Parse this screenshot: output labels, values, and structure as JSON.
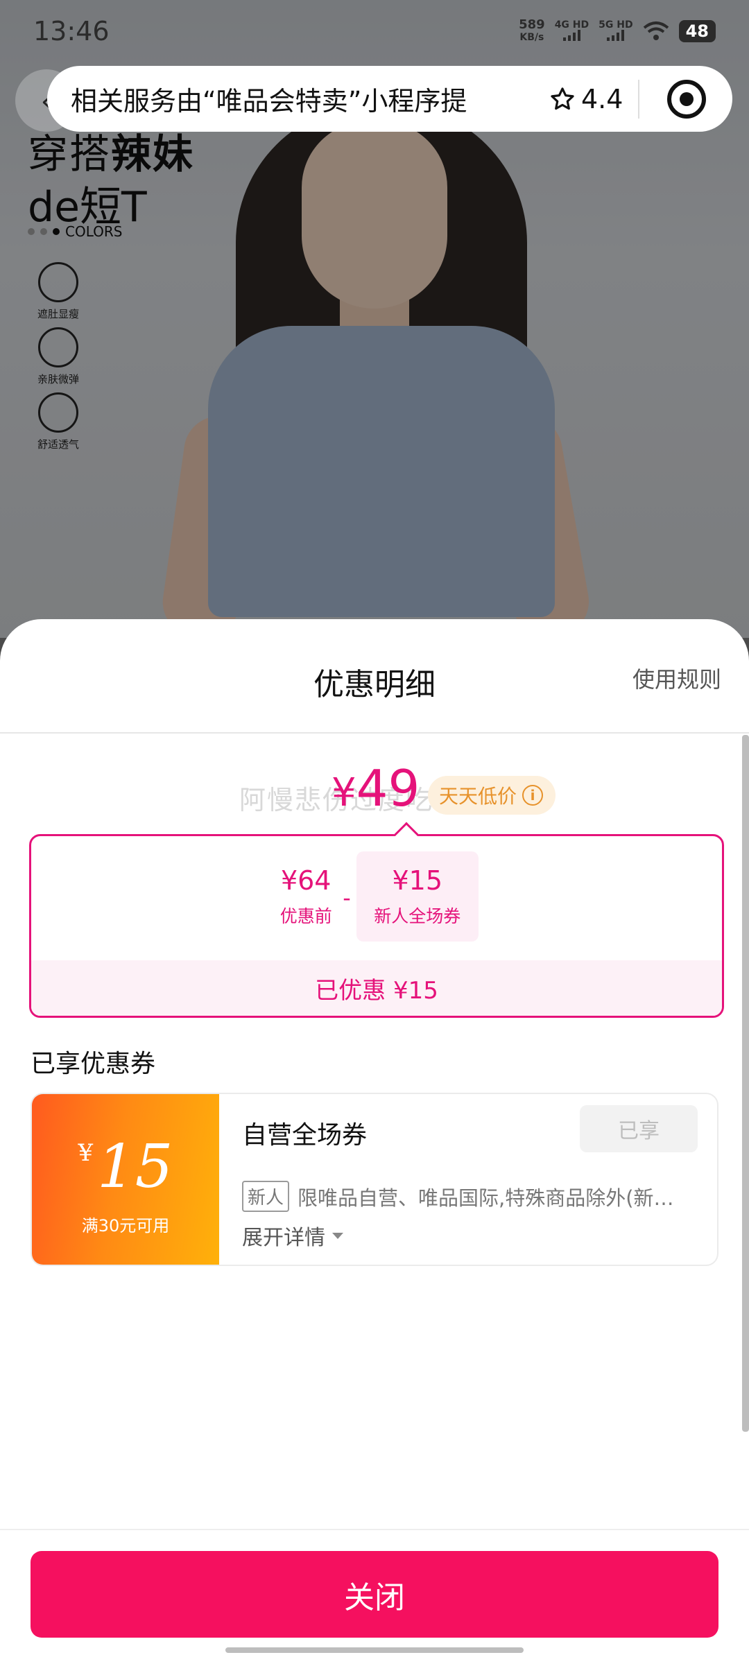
{
  "status_bar": {
    "time": "13:46",
    "net_speed_value": "589",
    "net_speed_unit": "KB/s",
    "sim1": "4G HD",
    "sim2": "5G HD",
    "battery": "48"
  },
  "capsule": {
    "text": "相关服务由“唯品会特卖”小程序提",
    "rating": "4.4"
  },
  "product_image": {
    "headline_light": "穿搭",
    "headline_bold": "辣妹",
    "headline_line2": "de短T",
    "colors_label": "COLORS",
    "features": [
      "遮肚显瘦",
      "亲肤微弹",
      "舒适透气"
    ]
  },
  "sheet": {
    "title": "优惠明细",
    "rules_link": "使用规则",
    "watermark": "阿慢悲伤过度吃嘛",
    "final_price_symbol": "¥",
    "final_price": "49",
    "low_price_badge": "天天低价",
    "calc": {
      "original_amount": "¥64",
      "original_label": "优惠前",
      "minus": "-",
      "discount_amount": "¥15",
      "discount_label": "新人全场券",
      "total_saved": "已优惠 ¥15"
    },
    "coupons_heading": "已享优惠券",
    "coupon": {
      "currency": "¥",
      "amount": "15",
      "condition": "满30元可用",
      "name": "自营全场券",
      "status_button": "已享",
      "tag": "新人",
      "description": "限唯品自营、唯品国际,特殊商品除外(新…",
      "expand_label": "展开详情"
    },
    "close_button": "关闭"
  },
  "colors": {
    "accent": "#e5127a",
    "close_button": "#f5105f",
    "badge_text": "#e7922b",
    "coupon_gradient_start": "#ff5a1f",
    "coupon_gradient_end": "#ffb10a"
  }
}
